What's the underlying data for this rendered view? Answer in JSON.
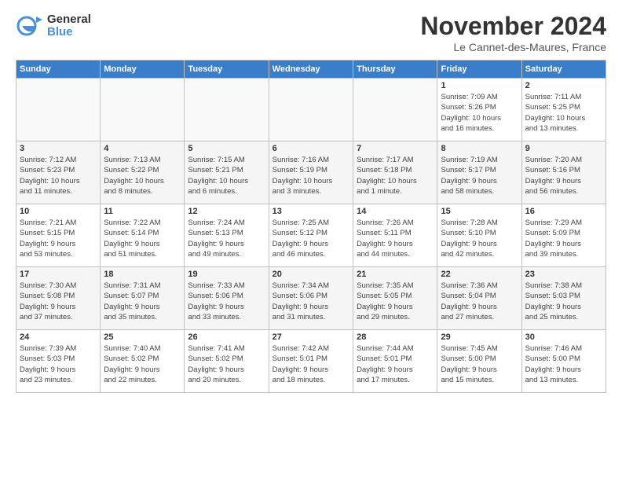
{
  "header": {
    "logo_line1": "General",
    "logo_line2": "Blue",
    "month_title": "November 2024",
    "location": "Le Cannet-des-Maures, France"
  },
  "weekdays": [
    "Sunday",
    "Monday",
    "Tuesday",
    "Wednesday",
    "Thursday",
    "Friday",
    "Saturday"
  ],
  "weeks": [
    [
      {
        "day": "",
        "info": ""
      },
      {
        "day": "",
        "info": ""
      },
      {
        "day": "",
        "info": ""
      },
      {
        "day": "",
        "info": ""
      },
      {
        "day": "",
        "info": ""
      },
      {
        "day": "1",
        "info": "Sunrise: 7:09 AM\nSunset: 5:26 PM\nDaylight: 10 hours\nand 16 minutes."
      },
      {
        "day": "2",
        "info": "Sunrise: 7:11 AM\nSunset: 5:25 PM\nDaylight: 10 hours\nand 13 minutes."
      }
    ],
    [
      {
        "day": "3",
        "info": "Sunrise: 7:12 AM\nSunset: 5:23 PM\nDaylight: 10 hours\nand 11 minutes."
      },
      {
        "day": "4",
        "info": "Sunrise: 7:13 AM\nSunset: 5:22 PM\nDaylight: 10 hours\nand 8 minutes."
      },
      {
        "day": "5",
        "info": "Sunrise: 7:15 AM\nSunset: 5:21 PM\nDaylight: 10 hours\nand 6 minutes."
      },
      {
        "day": "6",
        "info": "Sunrise: 7:16 AM\nSunset: 5:19 PM\nDaylight: 10 hours\nand 3 minutes."
      },
      {
        "day": "7",
        "info": "Sunrise: 7:17 AM\nSunset: 5:18 PM\nDaylight: 10 hours\nand 1 minute."
      },
      {
        "day": "8",
        "info": "Sunrise: 7:19 AM\nSunset: 5:17 PM\nDaylight: 9 hours\nand 58 minutes."
      },
      {
        "day": "9",
        "info": "Sunrise: 7:20 AM\nSunset: 5:16 PM\nDaylight: 9 hours\nand 56 minutes."
      }
    ],
    [
      {
        "day": "10",
        "info": "Sunrise: 7:21 AM\nSunset: 5:15 PM\nDaylight: 9 hours\nand 53 minutes."
      },
      {
        "day": "11",
        "info": "Sunrise: 7:22 AM\nSunset: 5:14 PM\nDaylight: 9 hours\nand 51 minutes."
      },
      {
        "day": "12",
        "info": "Sunrise: 7:24 AM\nSunset: 5:13 PM\nDaylight: 9 hours\nand 49 minutes."
      },
      {
        "day": "13",
        "info": "Sunrise: 7:25 AM\nSunset: 5:12 PM\nDaylight: 9 hours\nand 46 minutes."
      },
      {
        "day": "14",
        "info": "Sunrise: 7:26 AM\nSunset: 5:11 PM\nDaylight: 9 hours\nand 44 minutes."
      },
      {
        "day": "15",
        "info": "Sunrise: 7:28 AM\nSunset: 5:10 PM\nDaylight: 9 hours\nand 42 minutes."
      },
      {
        "day": "16",
        "info": "Sunrise: 7:29 AM\nSunset: 5:09 PM\nDaylight: 9 hours\nand 39 minutes."
      }
    ],
    [
      {
        "day": "17",
        "info": "Sunrise: 7:30 AM\nSunset: 5:08 PM\nDaylight: 9 hours\nand 37 minutes."
      },
      {
        "day": "18",
        "info": "Sunrise: 7:31 AM\nSunset: 5:07 PM\nDaylight: 9 hours\nand 35 minutes."
      },
      {
        "day": "19",
        "info": "Sunrise: 7:33 AM\nSunset: 5:06 PM\nDaylight: 9 hours\nand 33 minutes."
      },
      {
        "day": "20",
        "info": "Sunrise: 7:34 AM\nSunset: 5:06 PM\nDaylight: 9 hours\nand 31 minutes."
      },
      {
        "day": "21",
        "info": "Sunrise: 7:35 AM\nSunset: 5:05 PM\nDaylight: 9 hours\nand 29 minutes."
      },
      {
        "day": "22",
        "info": "Sunrise: 7:36 AM\nSunset: 5:04 PM\nDaylight: 9 hours\nand 27 minutes."
      },
      {
        "day": "23",
        "info": "Sunrise: 7:38 AM\nSunset: 5:03 PM\nDaylight: 9 hours\nand 25 minutes."
      }
    ],
    [
      {
        "day": "24",
        "info": "Sunrise: 7:39 AM\nSunset: 5:03 PM\nDaylight: 9 hours\nand 23 minutes."
      },
      {
        "day": "25",
        "info": "Sunrise: 7:40 AM\nSunset: 5:02 PM\nDaylight: 9 hours\nand 22 minutes."
      },
      {
        "day": "26",
        "info": "Sunrise: 7:41 AM\nSunset: 5:02 PM\nDaylight: 9 hours\nand 20 minutes."
      },
      {
        "day": "27",
        "info": "Sunrise: 7:42 AM\nSunset: 5:01 PM\nDaylight: 9 hours\nand 18 minutes."
      },
      {
        "day": "28",
        "info": "Sunrise: 7:44 AM\nSunset: 5:01 PM\nDaylight: 9 hours\nand 17 minutes."
      },
      {
        "day": "29",
        "info": "Sunrise: 7:45 AM\nSunset: 5:00 PM\nDaylight: 9 hours\nand 15 minutes."
      },
      {
        "day": "30",
        "info": "Sunrise: 7:46 AM\nSunset: 5:00 PM\nDaylight: 9 hours\nand 13 minutes."
      }
    ]
  ]
}
